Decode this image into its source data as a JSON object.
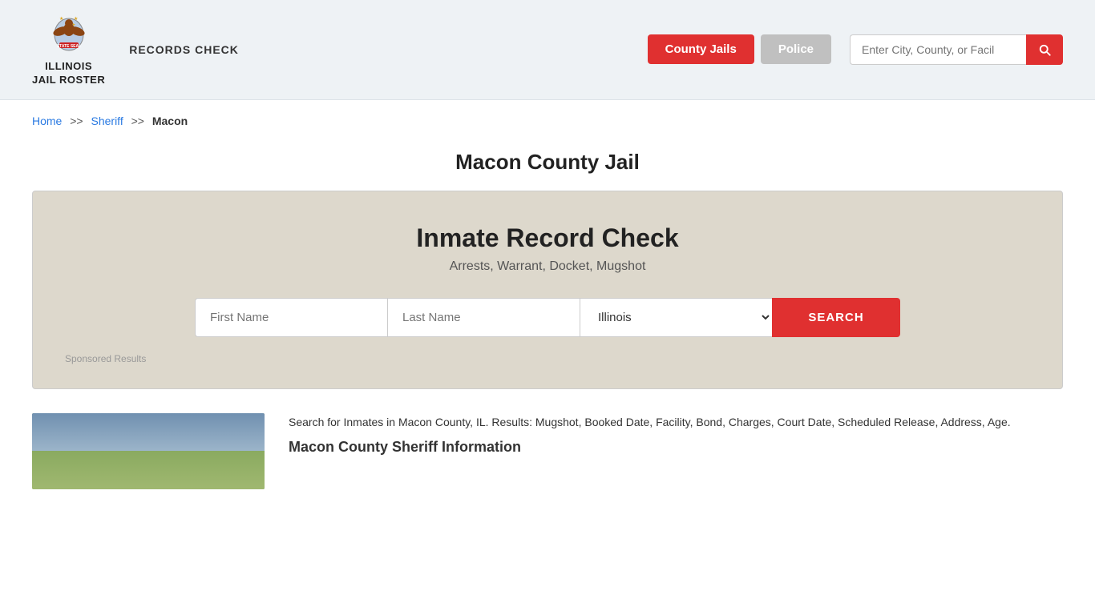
{
  "header": {
    "logo_line1": "ILLINOIS",
    "logo_line2": "JAIL ROSTER",
    "records_check_label": "RECORDS CHECK",
    "nav": {
      "county_jails_label": "County Jails",
      "police_label": "Police"
    },
    "search": {
      "placeholder": "Enter City, County, or Facil"
    }
  },
  "breadcrumb": {
    "home": "Home",
    "separator1": ">>",
    "sheriff": "Sheriff",
    "separator2": ">>",
    "current": "Macon"
  },
  "page": {
    "title": "Macon County Jail"
  },
  "inmate_box": {
    "title": "Inmate Record Check",
    "subtitle": "Arrests, Warrant, Docket, Mugshot",
    "first_name_placeholder": "First Name",
    "last_name_placeholder": "Last Name",
    "state_default": "Illinois",
    "search_button": "SEARCH",
    "sponsored_label": "Sponsored Results"
  },
  "bottom": {
    "description": "Search for Inmates in Macon County, IL. Results: Mugshot, Booked Date, Facility, Bond, Charges, Court Date, Scheduled Release, Address, Age.",
    "section_heading": "Macon County Sheriff Information"
  }
}
